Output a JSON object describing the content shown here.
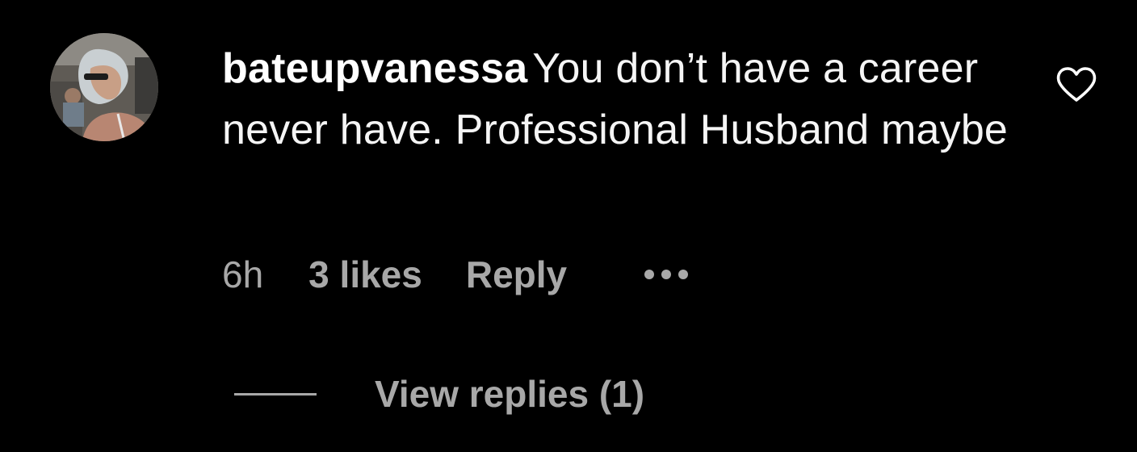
{
  "comment": {
    "username": "bateupvanessa",
    "text": "You don’t have a career never have. Professional Husband maybe",
    "time": "6h",
    "likes": "3 likes",
    "reply_label": "Reply",
    "view_replies_label": "View replies (1)"
  },
  "icons": {
    "like": "heart-outline-icon",
    "more": "more-horizontal-icon"
  },
  "colors": {
    "background": "#000000",
    "text_primary": "#ffffff",
    "text_secondary": "#a8a8a8"
  }
}
